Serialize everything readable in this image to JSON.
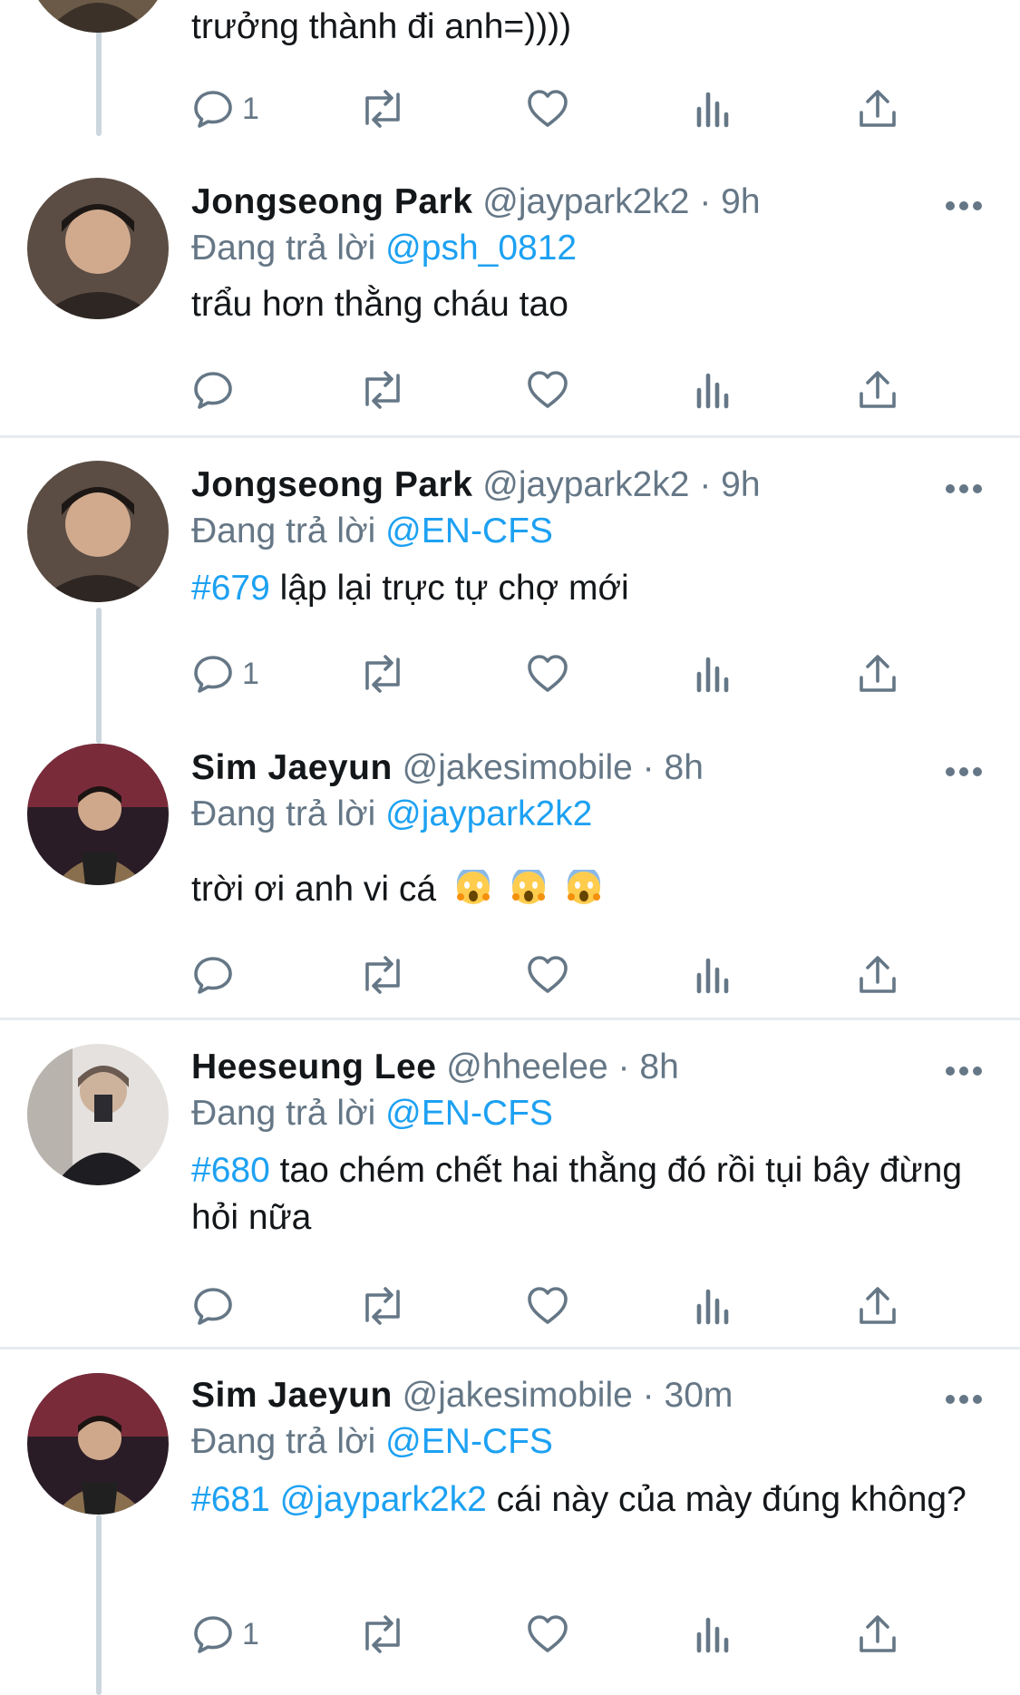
{
  "top_partial": {
    "content": "trưởng thành đi anh=))))",
    "reply_count": "1"
  },
  "replying_prefix": "Đang trả lời",
  "tweets": [
    {
      "name": "Jongseong Park",
      "handle": "@jaypark2k2",
      "dot": "·",
      "time": "9h",
      "replying_to": "@psh_0812",
      "hashtag": "",
      "content": "trẩu hơn thằng cháu tao",
      "reply_count": ""
    },
    {
      "name": "Jongseong Park",
      "handle": "@jaypark2k2",
      "dot": "·",
      "time": "9h",
      "replying_to": "@EN-CFS",
      "hashtag": "#679",
      "content": " lập lại trực tự chợ mới",
      "reply_count": "1"
    },
    {
      "name": "Sim Jaeyun",
      "handle": "@jakesimobile",
      "dot": "·",
      "time": "8h",
      "replying_to": "@jaypark2k2",
      "hashtag": "",
      "content": "trời ơi anh vi cá",
      "emoji": [
        "😱",
        "😱",
        "😱"
      ],
      "reply_count": ""
    },
    {
      "name": "Heeseung Lee",
      "handle": "@hheelee",
      "dot": "·",
      "time": "8h",
      "replying_to": "@EN-CFS",
      "hashtag": "#680",
      "content": " tao chém chết hai thằng đó rồi tụi bây đừng hỏi nữa",
      "reply_count": ""
    },
    {
      "name": "Sim Jaeyun",
      "handle": "@jakesimobile",
      "dot": "·",
      "time": "30m",
      "replying_to": "@EN-CFS",
      "hashtag": "#681",
      "mention_in_text": " @jaypark2k2",
      "content": " cái này của mày đúng không?",
      "reply_count": "1"
    }
  ],
  "icons": {
    "reply": "reply-bubble-icon",
    "retweet": "retweet-icon",
    "like": "heart-icon",
    "analytics": "analytics-bars-icon",
    "share": "share-upload-icon",
    "more": "more-dots-icon"
  },
  "colors": {
    "text": "#14171a",
    "secondary": "#657786",
    "link": "#1da1f2",
    "divider": "#e6ecf0",
    "thread_line": "#ccd6dd"
  }
}
